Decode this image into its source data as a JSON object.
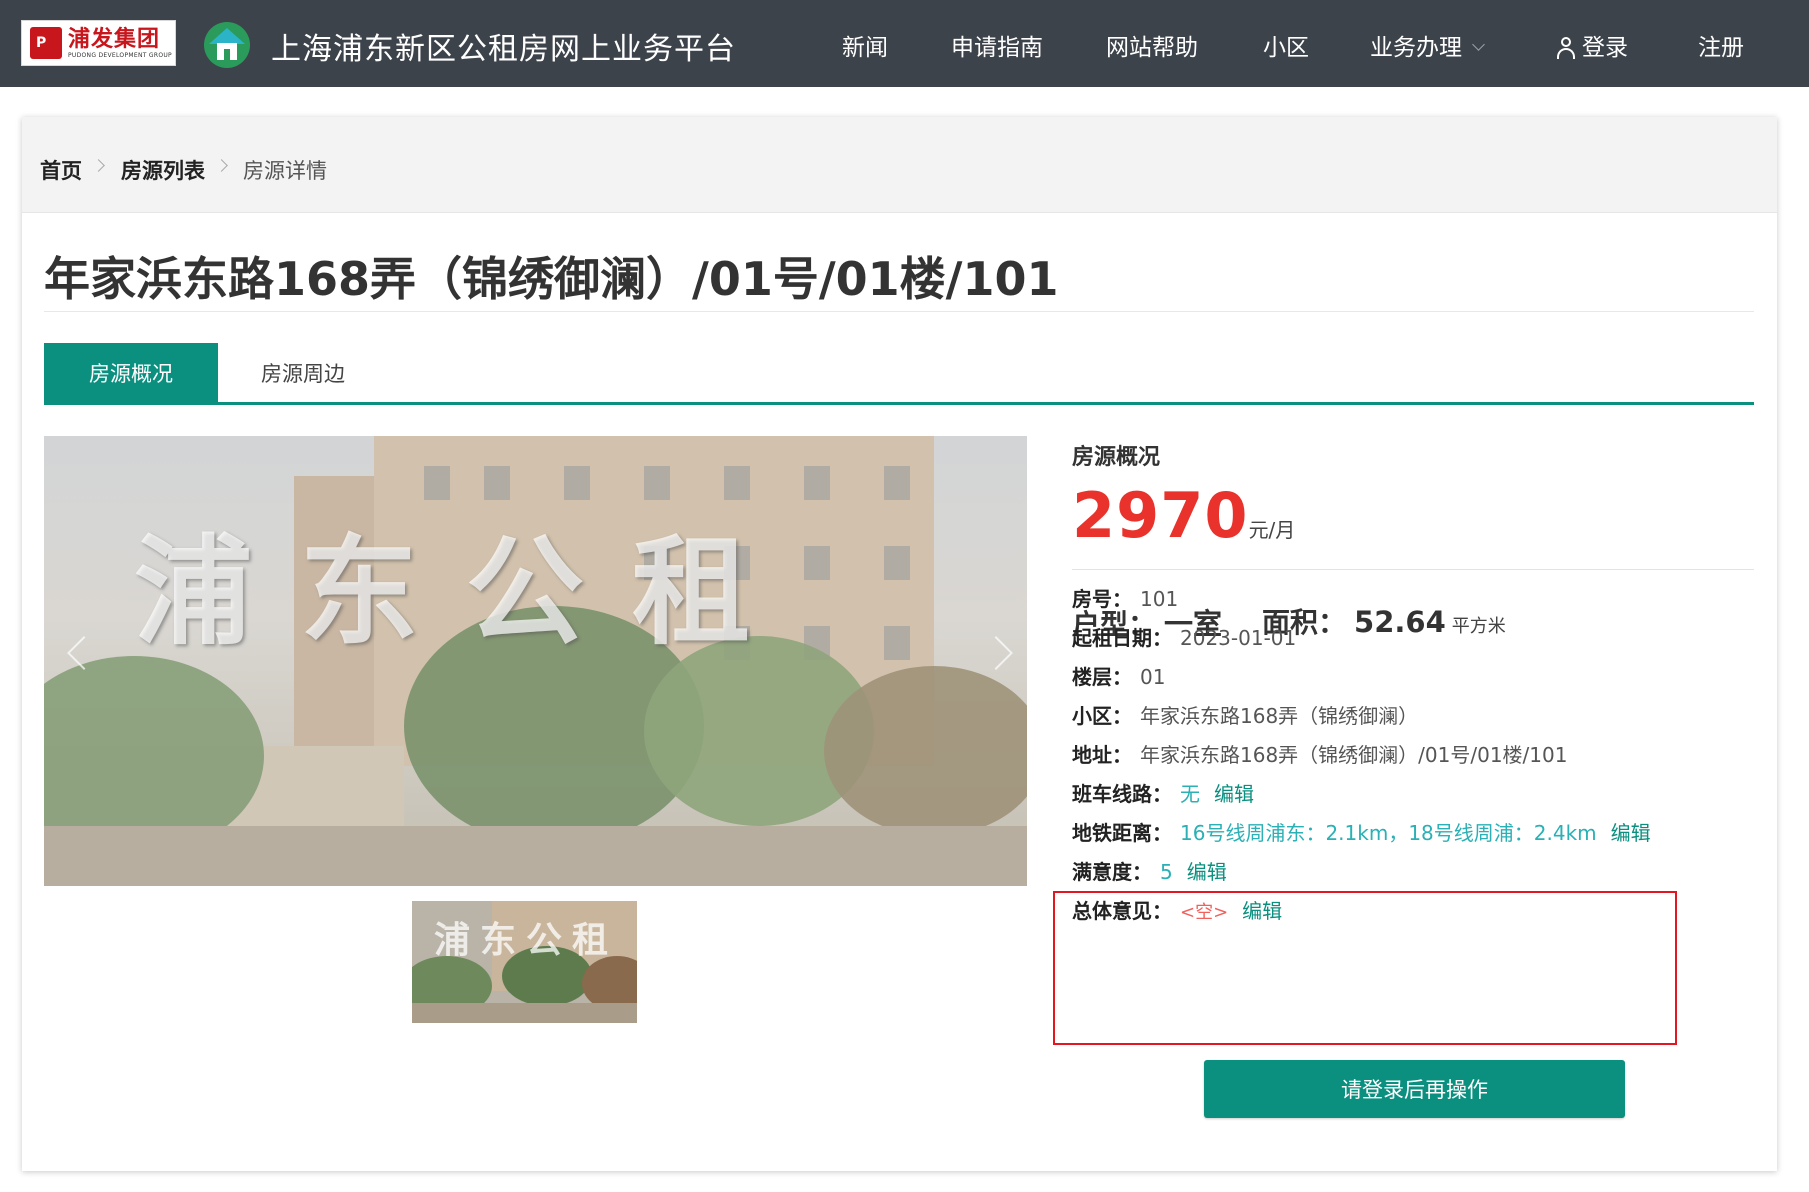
{
  "header": {
    "brand_name": "浦发集团",
    "brand_sub": "PUDONG DEVELOPMENT GROUP",
    "site_title": "上海浦东新区公租房网上业务平台",
    "nav": [
      "新闻",
      "申请指南",
      "网站帮助",
      "小区",
      "业务办理"
    ],
    "login": "登录",
    "register": "注册"
  },
  "breadcrumb": [
    "首页",
    "房源列表",
    "房源详情"
  ],
  "page_title": "年家浜东路168弄（锦绣御澜）/01号/01楼/101",
  "tabs": [
    "房源概况",
    "房源周边"
  ],
  "gallery": {
    "watermark": "浦东公租",
    "thumb_watermark": "浦东公租"
  },
  "info": {
    "heading": "房源概况",
    "price": "2970",
    "price_unit": "元/月",
    "layout_label": "户型：",
    "layout_value": "一室",
    "area_label": "面积：",
    "area_value": "52.64",
    "area_unit": "平方米",
    "rows": [
      {
        "label": "房号：",
        "value": "101"
      },
      {
        "label": "起租日期：",
        "value": "2023-01-01"
      },
      {
        "label": "楼层：",
        "value": "01"
      },
      {
        "label": "小区：",
        "value": "年家浜东路168弄（锦绣御澜）"
      },
      {
        "label": "地址：",
        "value": "年家浜东路168弄（锦绣御澜）/01号/01楼/101"
      }
    ],
    "editable_rows": [
      {
        "label": "班车线路：",
        "value": "无",
        "edit": "编辑"
      },
      {
        "label": "地铁距离：",
        "value": "16号线周浦东：2.1km，18号线周浦：2.4km",
        "edit": "编辑"
      },
      {
        "label": "满意度：",
        "value": "5",
        "edit": "编辑"
      },
      {
        "label": "总体意见：",
        "value": "<空>",
        "edit": "编辑"
      }
    ]
  },
  "action_button": "请登录后再操作",
  "colors": {
    "topbar": "#3d434b",
    "teal": "#0b9080",
    "price_red": "#e8322b",
    "highlight_red": "#e4161f",
    "link_cyan": "#2ab0b5"
  }
}
